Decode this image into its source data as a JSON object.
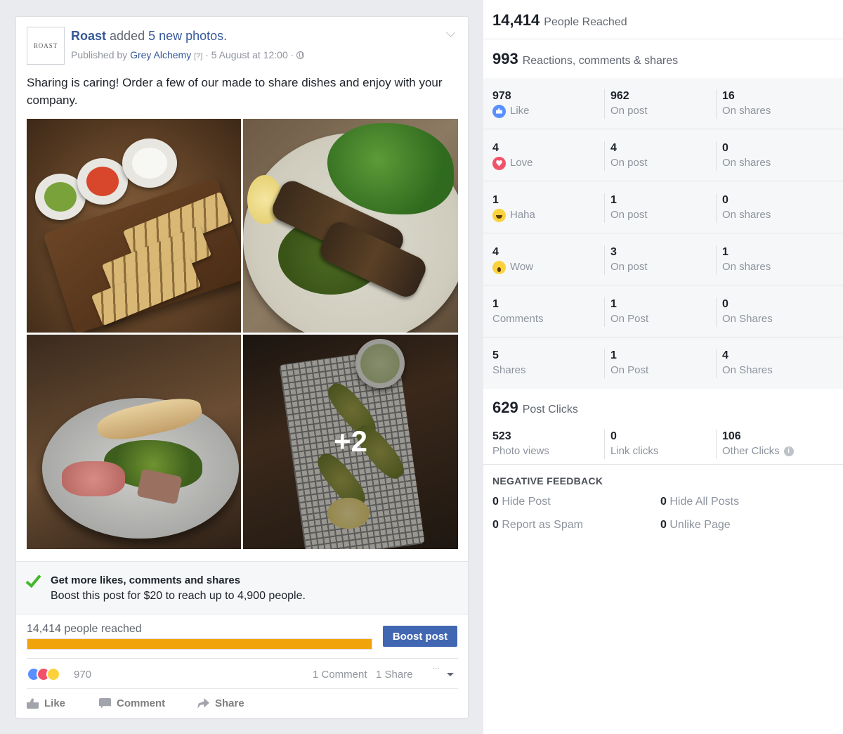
{
  "post": {
    "page_name": "Roast",
    "avatar_text": "ROAST",
    "action_verb": "added",
    "action_object": "5 new photos.",
    "published_prefix": "Published by",
    "publisher": "Grey Alchemy",
    "help_marker": "[?]",
    "date": "· 5 August at 12:00 ·",
    "text": "Sharing is caring! Order a few of our made to share dishes and enjoy with your company.",
    "more_photos": "+2",
    "boost": {
      "title": "Get more likes, comments and shares",
      "subtitle": "Boost this post for $20 to reach up to 4,900 people.",
      "reach_label": "14,414 people reached",
      "button": "Boost post",
      "reach_fraction": 1.0
    },
    "reactions": {
      "count": "970",
      "comments": "1 Comment",
      "shares": "1 Share"
    },
    "actions": {
      "like": "Like",
      "comment": "Comment",
      "share": "Share"
    }
  },
  "insights": {
    "reach": {
      "value": "14,414",
      "label": "People Reached"
    },
    "engagement": {
      "value": "993",
      "label": "Reactions, comments & shares"
    },
    "rows": [
      {
        "total": "978",
        "label": "Like",
        "icon": "like",
        "post": "962",
        "post_label": "On post",
        "shares": "16",
        "shares_label": "On shares"
      },
      {
        "total": "4",
        "label": "Love",
        "icon": "love",
        "post": "4",
        "post_label": "On post",
        "shares": "0",
        "shares_label": "On shares"
      },
      {
        "total": "1",
        "label": "Haha",
        "icon": "haha",
        "post": "1",
        "post_label": "On post",
        "shares": "0",
        "shares_label": "On shares"
      },
      {
        "total": "4",
        "label": "Wow",
        "icon": "wow",
        "post": "3",
        "post_label": "On post",
        "shares": "1",
        "shares_label": "On shares"
      },
      {
        "total": "1",
        "label": "Comments",
        "icon": "",
        "post": "1",
        "post_label": "On Post",
        "shares": "0",
        "shares_label": "On Shares"
      },
      {
        "total": "5",
        "label": "Shares",
        "icon": "",
        "post": "1",
        "post_label": "On Post",
        "shares": "4",
        "shares_label": "On Shares"
      }
    ],
    "clicks": {
      "value": "629",
      "label": "Post Clicks",
      "photo_views": "523",
      "photo_views_label": "Photo views",
      "link_clicks": "0",
      "link_clicks_label": "Link clicks",
      "other_clicks": "106",
      "other_clicks_label": "Other Clicks"
    },
    "negative": {
      "title": "NEGATIVE FEEDBACK",
      "hide_post": "0",
      "hide_post_label": "Hide Post",
      "hide_all": "0",
      "hide_all_label": "Hide All Posts",
      "spam": "0",
      "spam_label": "Report as Spam",
      "unlike": "0",
      "unlike_label": "Unlike Page"
    }
  }
}
